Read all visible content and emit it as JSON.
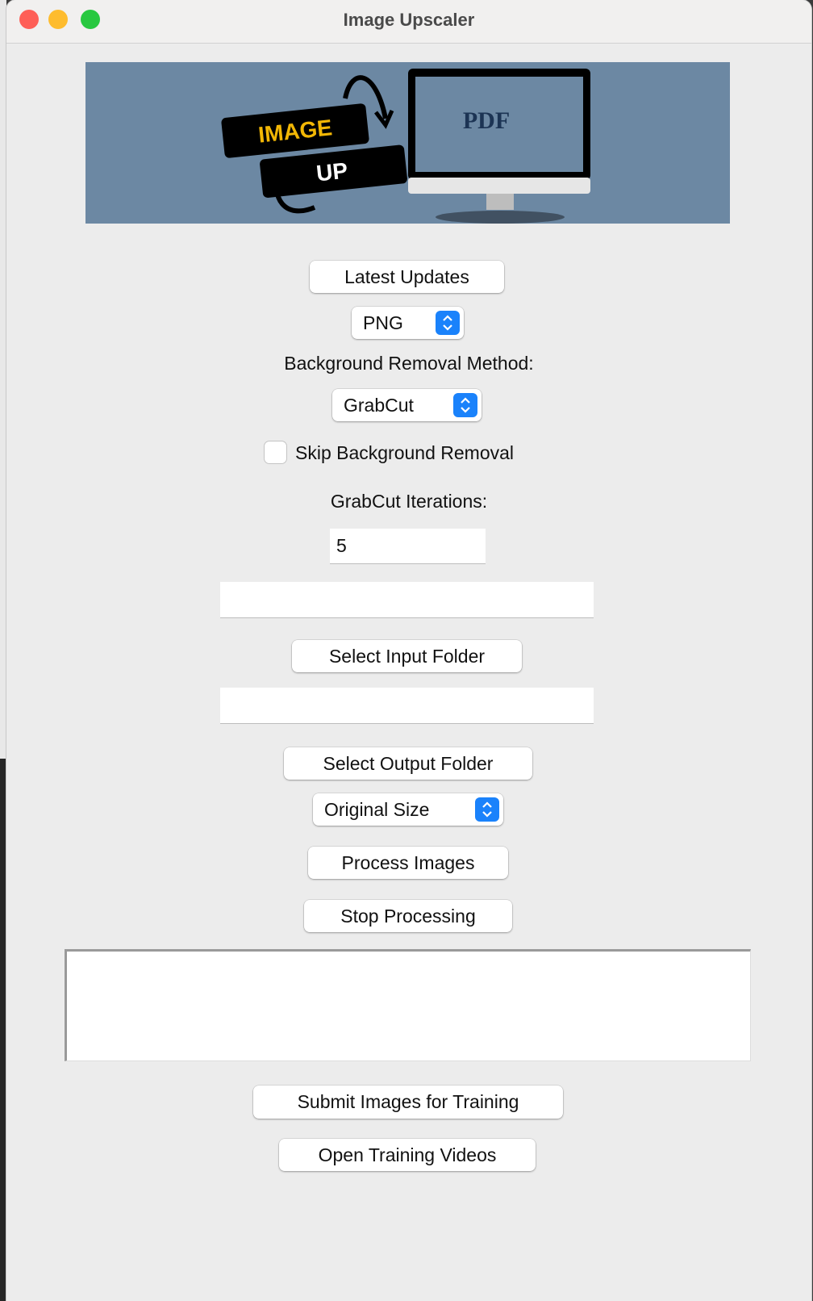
{
  "window": {
    "title": "Image Upscaler"
  },
  "banner": {
    "logo_word1": "IMAGE",
    "logo_word2": "UP",
    "screen_logo": "PDF",
    "bg_color": "#6c88a3"
  },
  "buttons": {
    "latest_updates": "Latest Updates",
    "select_input": "Select Input Folder",
    "select_output": "Select Output Folder",
    "process": "Process Images",
    "stop": "Stop Processing",
    "submit_training": "Submit Images for Training",
    "open_videos": "Open Training Videos"
  },
  "format_select": {
    "value": "PNG"
  },
  "bg_method": {
    "label": "Background Removal Method:",
    "value": "GrabCut"
  },
  "skip_bg": {
    "label": "Skip Background Removal",
    "checked": false
  },
  "iterations": {
    "label": "GrabCut Iterations:",
    "value": "5"
  },
  "input_folder": {
    "value": ""
  },
  "output_folder": {
    "value": ""
  },
  "size_select": {
    "value": "Original Size"
  },
  "log": {
    "value": ""
  },
  "colors": {
    "accent": "#1a82fb",
    "close": "#fe5f57",
    "minimize": "#febc2e",
    "zoom": "#28c840"
  }
}
